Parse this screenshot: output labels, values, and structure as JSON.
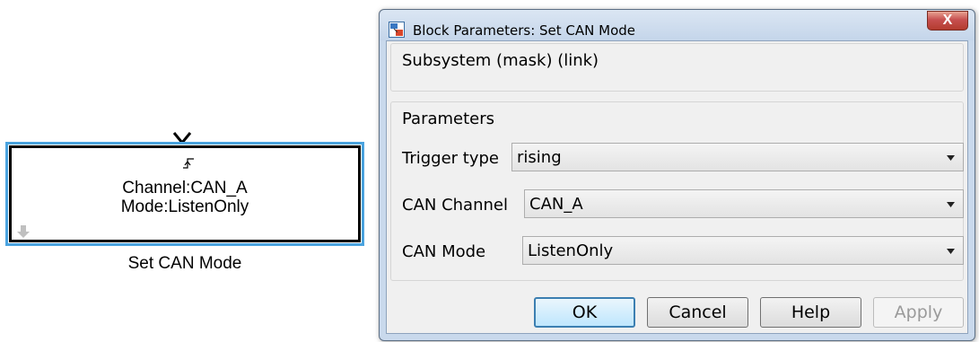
{
  "block": {
    "line1": "Channel:CAN_A",
    "line2": "Mode:ListenOnly",
    "name": "Set CAN Mode"
  },
  "dialog": {
    "title": "Block Parameters: Set CAN Mode",
    "close_label": "X",
    "header": "Subsystem (mask) (link)",
    "params_label": "Parameters",
    "fields": [
      {
        "label": "Trigger type",
        "value": "rising"
      },
      {
        "label": "CAN Channel",
        "value": "CAN_A"
      },
      {
        "label": "CAN Mode",
        "value": "ListenOnly"
      }
    ],
    "buttons": {
      "ok": "OK",
      "cancel": "Cancel",
      "help": "Help",
      "apply": "Apply"
    }
  },
  "colors": {
    "selection": "#4aa3df",
    "close_button": "#c75050"
  },
  "icons": [
    "trigger-port-icon",
    "rising-edge-icon",
    "down-arrow-icon",
    "app-icon",
    "chevron-down-icon"
  ]
}
